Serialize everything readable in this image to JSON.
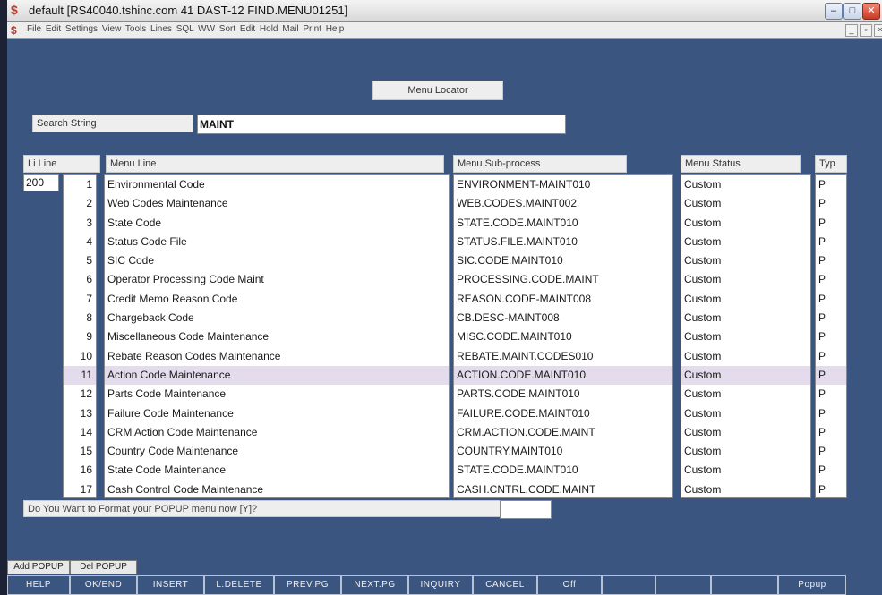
{
  "window": {
    "title": "default  [RS40040.tshinc.com 41 DAST-12 FIND.MENU01251]",
    "menu_items": "File  Edit  Settings  View  Tools  Lines  SQL  WW  Sort  Edit  Hold  Mail  Print  Help"
  },
  "heading": "Menu Locator",
  "search": {
    "label": "Search String",
    "value": "MAINT"
  },
  "columns": {
    "li": "Li Line",
    "menu_line": "Menu Line",
    "sub_process": "Menu Sub-process",
    "status": "Menu Status",
    "type": "Typ"
  },
  "li_value": "200",
  "rows": [
    {
      "num": "1",
      "line": "Environmental Code",
      "sub": "ENVIRONMENT-MAINT010",
      "status": "Custom",
      "typ": "P"
    },
    {
      "num": "2",
      "line": "Web Codes Maintenance",
      "sub": "WEB.CODES.MAINT002",
      "status": "Custom",
      "typ": "P"
    },
    {
      "num": "3",
      "line": "State Code",
      "sub": "STATE.CODE.MAINT010",
      "status": "Custom",
      "typ": "P"
    },
    {
      "num": "4",
      "line": "Status Code File",
      "sub": "STATUS.FILE.MAINT010",
      "status": "Custom",
      "typ": "P"
    },
    {
      "num": "5",
      "line": "SIC Code",
      "sub": "SIC.CODE.MAINT010",
      "status": "Custom",
      "typ": "P"
    },
    {
      "num": "6",
      "line": "Operator Processing Code Maint",
      "sub": "PROCESSING.CODE.MAINT",
      "status": "Custom",
      "typ": "P"
    },
    {
      "num": "7",
      "line": "Credit Memo Reason Code",
      "sub": "REASON.CODE-MAINT008",
      "status": "Custom",
      "typ": "P"
    },
    {
      "num": "8",
      "line": "Chargeback Code",
      "sub": "CB.DESC-MAINT008",
      "status": "Custom",
      "typ": "P"
    },
    {
      "num": "9",
      "line": "Miscellaneous Code Maintenance",
      "sub": "MISC.CODE.MAINT010",
      "status": "Custom",
      "typ": "P"
    },
    {
      "num": "10",
      "line": "Rebate Reason Codes Maintenance",
      "sub": "REBATE.MAINT.CODES010",
      "status": "Custom",
      "typ": "P"
    },
    {
      "num": "11",
      "line": "Action Code Maintenance",
      "sub": "ACTION.CODE.MAINT010",
      "status": "Custom",
      "typ": "P"
    },
    {
      "num": "12",
      "line": "Parts Code Maintenance",
      "sub": "PARTS.CODE.MAINT010",
      "status": "Custom",
      "typ": "P"
    },
    {
      "num": "13",
      "line": "Failure Code Maintenance",
      "sub": "FAILURE.CODE.MAINT010",
      "status": "Custom",
      "typ": "P"
    },
    {
      "num": "14",
      "line": "CRM Action Code Maintenance",
      "sub": "CRM.ACTION.CODE.MAINT",
      "status": "Custom",
      "typ": "P"
    },
    {
      "num": "15",
      "line": "Country Code Maintenance",
      "sub": "COUNTRY.MAINT010",
      "status": "Custom",
      "typ": "P"
    },
    {
      "num": "16",
      "line": "State Code Maintenance",
      "sub": "STATE.CODE.MAINT010",
      "status": "Custom",
      "typ": "P"
    },
    {
      "num": "17",
      "line": "Cash Control Code Maintenance",
      "sub": "CASH.CNTRL.CODE.MAINT",
      "status": "Custom",
      "typ": "P"
    }
  ],
  "selected_row": 11,
  "question": "Do You Want to Format your POPUP menu now [Y]?",
  "answer": "",
  "fkeys_top": [
    "Add POPUP",
    "Del POPUP",
    "",
    "",
    "",
    "",
    "",
    "",
    "",
    "",
    "",
    "",
    ""
  ],
  "fkeys": [
    "HELP",
    "OK/END",
    "INSERT",
    "L.DELETE",
    "PREV.PG",
    "NEXT.PG",
    "INQUIRY",
    "CANCEL",
    "Off",
    "",
    "",
    "",
    "Popup"
  ]
}
